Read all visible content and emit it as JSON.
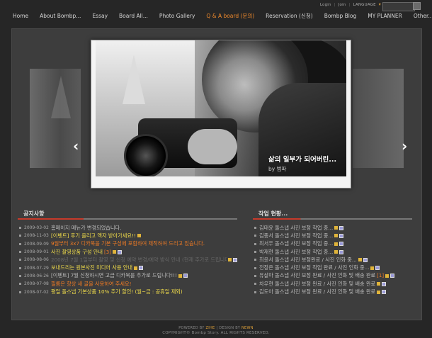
{
  "topbar": {
    "login": "Login",
    "join": "Join",
    "language": "LANGUAGE",
    "search_placeholder": ""
  },
  "nav": [
    {
      "label": "Home",
      "active": false
    },
    {
      "label": "About Bombp...",
      "active": false
    },
    {
      "label": "Essay",
      "active": false
    },
    {
      "label": "Board All...",
      "active": false
    },
    {
      "label": "Photo Gallery",
      "active": false
    },
    {
      "label": "Q & A board (문의)",
      "active": true
    },
    {
      "label": "Reservation (신청)",
      "active": false
    },
    {
      "label": "Bombp Blog",
      "active": false
    },
    {
      "label": "MY PLANNER",
      "active": false
    },
    {
      "label": "Other...",
      "active": false
    }
  ],
  "slider": {
    "caption_title": "삶의 일부가 되어버린...",
    "caption_by": "by 범파"
  },
  "notice": {
    "title": "공지사항",
    "rows": [
      {
        "date": "2009-03-02",
        "text": "홈페이지 메뉴가 변경되었습니다.",
        "color": "",
        "count": "",
        "icons": []
      },
      {
        "date": "2008-11-03",
        "text": "[이벤트] 후기 올리고 액자 받아가세요!!",
        "color": "yellow",
        "count": "",
        "icons": [
          "n"
        ]
      },
      {
        "date": "2008-09-09",
        "text": "9월부터 3x7 디카북을 기본 구성에 포함하여 제작하여 드리고 있습니다.",
        "color": "orange",
        "count": "",
        "icons": []
      },
      {
        "date": "2008-09-01",
        "text": "사진 촬영상품 구성 안내",
        "color": "yellow",
        "count": "[3]",
        "icons": [
          "n",
          "p"
        ]
      },
      {
        "date": "2008-08-06",
        "text": "2008년 7월 1일부터 촬영 및 신청 예약 변경/예약 방식 안내 (현재 추가로 드립니다)",
        "color": "dim",
        "count": "",
        "icons": [
          "n",
          "p"
        ]
      },
      {
        "date": "2008-07-29",
        "text": "보내드리는 원본사진 미디어 사용 안내",
        "color": "yellow",
        "count": "",
        "icons": [
          "n",
          "p"
        ]
      },
      {
        "date": "2008-06-26",
        "text": "[이벤트] 7월 신청하시면 고급 디카북를 추가로 드립니다!!!",
        "color": "",
        "count": "",
        "icons": [
          "n",
          "p"
        ]
      },
      {
        "date": "2008-07-08",
        "text": "필름은 항상 새 골을 사용하여 주세요!",
        "color": "orange",
        "count": "",
        "icons": []
      },
      {
        "date": "2008-07-02",
        "text": "평일 돌스냅 기본상품 10% 추가 할인! (월~금 : 공휴일 제외)",
        "color": "yellow",
        "count": "",
        "icons": []
      }
    ]
  },
  "work": {
    "title": "작업 현황...",
    "rows": [
      {
        "text": "김태윤 돌스냅 사진 보정 작업 중...",
        "count": ""
      },
      {
        "text": "김종서 돌스냅 사진 보정 작업 중...",
        "count": ""
      },
      {
        "text": "최서우 돌스냅 사진 보정 작업 중...",
        "count": ""
      },
      {
        "text": "박재현 돌스냅 사진 보정 작업 중...",
        "count": ""
      },
      {
        "text": "최윤서 돌스냅 사진 보정완료 / 사진 인화 중...",
        "count": ""
      },
      {
        "text": "전장은 돌스냅 사진 보정 작업 완료 / 사진 인화 중...",
        "count": ""
      },
      {
        "text": "유살마 돌스냅 사진 보정 완료 / 사진 인화 및 배송 완료",
        "count": "[1]"
      },
      {
        "text": "차우현 돌스냅 사진 보정 완료 / 사진 인화 및 배송 완료",
        "count": ""
      },
      {
        "text": "김도아 돌스냅 사진 보정 완료 / 사진 인화 및 배송 완료",
        "count": ""
      }
    ]
  },
  "footer": {
    "powered_by": "POWERED BY",
    "powered_name": "ZIHE",
    "design_by": "DESIGN BY",
    "design_name": "NEWN",
    "copyright": "COPYRIGHT© Bombp Story. ALL RIGHTS RESERVED."
  },
  "colors": {
    "accent": "#f08a2c",
    "highlight": "#f0dc4a",
    "rule_red": "#c83a2a"
  }
}
